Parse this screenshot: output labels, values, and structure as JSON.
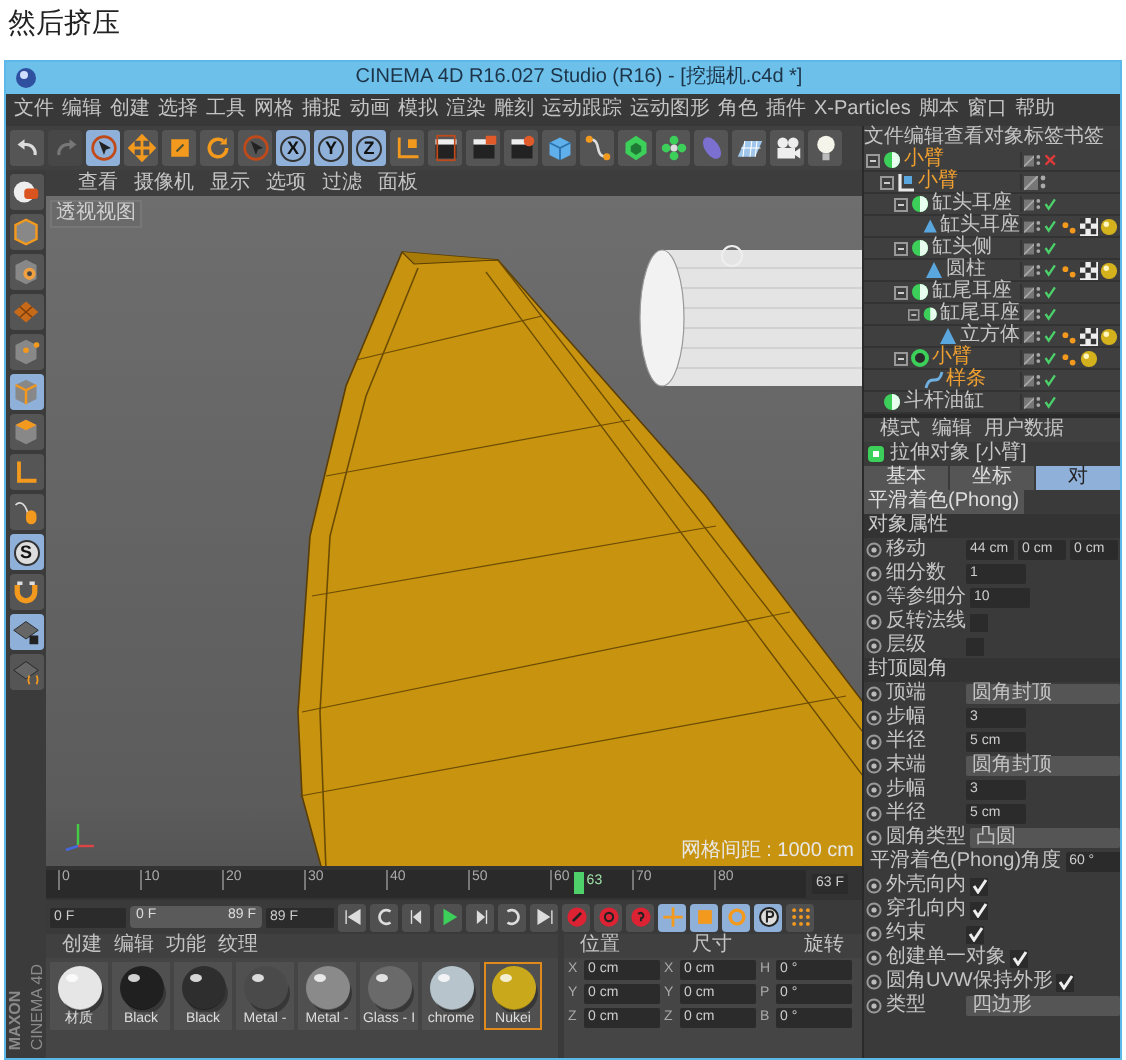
{
  "caption": "然后挤压",
  "window": {
    "title": "CINEMA 4D R16.027 Studio (R16) - [挖掘机.c4d *]"
  },
  "menu": [
    "文件",
    "编辑",
    "创建",
    "选择",
    "工具",
    "网格",
    "捕捉",
    "动画",
    "模拟",
    "渲染",
    "雕刻",
    "运动跟踪",
    "运动图形",
    "角色",
    "插件",
    "X-Particles",
    "脚本",
    "窗口",
    "帮助"
  ],
  "toolbar": [
    {
      "selected": false,
      "disabled": false
    },
    {
      "selected": false,
      "disabled": true
    },
    {
      "selected": true,
      "disabled": false
    },
    {
      "selected": false,
      "disabled": false
    },
    {
      "selected": false,
      "disabled": false
    },
    {
      "selected": false,
      "disabled": false
    },
    {
      "selected": false,
      "disabled": false
    },
    {
      "label": "X",
      "selected": true,
      "disabled": false
    },
    {
      "label": "Y",
      "selected": true,
      "disabled": false
    },
    {
      "label": "Z",
      "selected": true,
      "disabled": false
    },
    {
      "selected": false,
      "disabled": false
    },
    {
      "selected": false,
      "disabled": false
    },
    {
      "selected": false,
      "disabled": false
    },
    {
      "selected": false,
      "disabled": false
    },
    {
      "selected": false,
      "disabled": false
    },
    {
      "selected": false,
      "disabled": false
    },
    {
      "selected": false,
      "disabled": false
    },
    {
      "selected": false,
      "disabled": false
    },
    {
      "selected": false,
      "disabled": false
    },
    {
      "selected": false,
      "disabled": false
    },
    {
      "selected": false,
      "disabled": false
    },
    {
      "selected": false,
      "disabled": false
    }
  ],
  "left_toolbar": [
    {
      "selected": false
    },
    {
      "selected": false
    },
    {
      "selected": false
    },
    {
      "selected": false
    },
    {
      "selected": false
    },
    {
      "selected": true
    },
    {
      "selected": false
    },
    {
      "selected": false
    },
    {
      "selected": false
    },
    {
      "label": "S",
      "selected": true
    },
    {
      "selected": false
    },
    {
      "selected": true
    },
    {
      "selected": false
    }
  ],
  "viewport": {
    "menu": [
      "查看",
      "摄像机",
      "显示",
      "选项",
      "过滤",
      "面板"
    ],
    "label": "透视视图",
    "grid_spacing": "网格间距 : 1000 cm"
  },
  "timeline": {
    "ticks": [
      "0",
      "10",
      "20",
      "30",
      "40",
      "50",
      "60",
      "70",
      "80"
    ],
    "playhead": {
      "label": "63",
      "level": 0.7
    },
    "frame_field": "63 F"
  },
  "playback": {
    "start": "0 F",
    "range": {
      "labels": [
        "0 F",
        "89 F"
      ],
      "level": 1
    },
    "end": "89 F",
    "modes": [
      {
        "selected": true
      },
      {
        "selected": true
      },
      {
        "selected": true
      },
      {
        "selected": true
      },
      {
        "selected": false
      }
    ]
  },
  "materials": {
    "menu": [
      "创建",
      "编辑",
      "功能",
      "纹理"
    ],
    "items": [
      {
        "name": "材质",
        "color": "#e6e6e6",
        "selected": false
      },
      {
        "name": "Black",
        "color": "#202020",
        "selected": false
      },
      {
        "name": "Black",
        "color": "#2e2e2e",
        "selected": false
      },
      {
        "name": "Metal -",
        "color": "#4a4a4a",
        "selected": false
      },
      {
        "name": "Metal -",
        "color": "#8a8a8a",
        "selected": false
      },
      {
        "name": "Glass - I",
        "color": "#6a6a6a",
        "selected": false
      },
      {
        "name": "chrome",
        "color": "#b8c4cc",
        "selected": false
      },
      {
        "name": "Nukei",
        "color": "#c9a81c",
        "selected": true
      }
    ]
  },
  "coordinates": {
    "headers": [
      "位置",
      "尺寸",
      "旋转"
    ],
    "rows": [
      [
        {
          "axis": "X",
          "value": "0 cm"
        },
        {
          "axis": "X",
          "value": "0 cm"
        },
        {
          "axis": "H",
          "value": "0 °"
        }
      ],
      [
        {
          "axis": "Y",
          "value": "0 cm"
        },
        {
          "axis": "Y",
          "value": "0 cm"
        },
        {
          "axis": "P",
          "value": "0 °"
        }
      ],
      [
        {
          "axis": "Z",
          "value": "0 cm"
        },
        {
          "axis": "Z",
          "value": "0 cm"
        },
        {
          "axis": "B",
          "value": "0 °"
        }
      ]
    ]
  },
  "logo": {
    "brand": "MAXON",
    "product": "CINEMA 4D"
  },
  "objects": {
    "menu": [
      "文件",
      "编辑",
      "查看",
      "对象",
      "标签",
      "书签"
    ],
    "tree": [
      {
        "name": "小臂",
        "kind": "null",
        "selected": true,
        "enabled": false,
        "children": [
          {
            "name": "小臂",
            "kind": "extrude",
            "selected": true,
            "children": [
              {
                "name": "缸头耳座",
                "kind": "null",
                "selected": false,
                "enabled": true,
                "children": [
                  {
                    "name": "缸头耳座",
                    "kind": "polygon",
                    "selected": false,
                    "enabled": true,
                    "tags": [
                      {
                        "kind": "phong"
                      },
                      {
                        "kind": "uvw"
                      },
                      {
                        "kind": "material"
                      }
                    ]
                  }
                ]
              },
              {
                "name": "缸头侧",
                "kind": "null",
                "selected": false,
                "enabled": true,
                "children": [
                  {
                    "name": "圆柱",
                    "kind": "polygon",
                    "selected": false,
                    "enabled": true,
                    "tags": [
                      {
                        "kind": "phong"
                      },
                      {
                        "kind": "uvw"
                      },
                      {
                        "kind": "material"
                      }
                    ]
                  }
                ]
              },
              {
                "name": "缸尾耳座",
                "kind": "null",
                "selected": false,
                "enabled": true,
                "children": [
                  {
                    "name": "缸尾耳座",
                    "kind": "null",
                    "selected": false,
                    "enabled": true,
                    "children": [
                      {
                        "name": "立方体",
                        "kind": "polygon",
                        "selected": false,
                        "enabled": true,
                        "tags": [
                          {
                            "kind": "phong"
                          },
                          {
                            "kind": "uvw"
                          },
                          {
                            "kind": "material"
                          }
                        ]
                      }
                    ]
                  }
                ]
              },
              {
                "name": "小臂",
                "kind": "subdiv",
                "selected": true,
                "enabled": true,
                "tags": [
                  {
                    "kind": "phong"
                  },
                  {
                    "kind": "material"
                  }
                ],
                "children": [
                  {
                    "name": "样条",
                    "kind": "spline",
                    "selected": true,
                    "enabled": true
                  }
                ]
              }
            ]
          }
        ]
      },
      {
        "name": "斗杆油缸",
        "kind": "null",
        "selected": false,
        "enabled": true
      }
    ]
  },
  "attributes": {
    "menu": [
      "模式",
      "编辑",
      "用户数据"
    ],
    "title": "拉伸对象 [小臂]",
    "tabs": [
      {
        "label": "基本",
        "selected": false
      },
      {
        "label": "坐标",
        "selected": false
      },
      {
        "label": "对",
        "selected": true
      },
      {
        "label": "平滑着色(Phong)",
        "selected": false
      }
    ],
    "sections": [
      {
        "title": "对象属性",
        "rows": [
          {
            "kind": "fields",
            "label": "移动",
            "values": [
              "44 cm",
              "0 cm",
              "0 cm"
            ]
          },
          {
            "kind": "fields",
            "label": "细分数",
            "values": [
              "1"
            ]
          },
          {
            "kind": "fields",
            "label": "等参细分",
            "values": [
              "10"
            ]
          },
          {
            "kind": "check",
            "label": "反转法线",
            "checked": false
          },
          {
            "kind": "check",
            "label": "层级",
            "checked": false
          }
        ]
      },
      {
        "title": "封顶圆角",
        "rows": [
          {
            "kind": "select",
            "label": "顶端",
            "value": "圆角封顶"
          },
          {
            "kind": "fields",
            "label": "步幅",
            "values": [
              "3"
            ]
          },
          {
            "kind": "fields",
            "label": "半径",
            "values": [
              "5 cm"
            ]
          },
          {
            "kind": "select",
            "label": "末端",
            "value": "圆角封顶"
          },
          {
            "kind": "fields",
            "label": "步幅",
            "values": [
              "3"
            ]
          },
          {
            "kind": "fields",
            "label": "半径",
            "values": [
              "5 cm"
            ]
          },
          {
            "kind": "select",
            "label": "圆角类型",
            "value": "凸圆"
          },
          {
            "kind": "fields",
            "label": "平滑着色(Phong)角度",
            "values": [
              "60 °"
            ]
          },
          {
            "kind": "check",
            "label": "外壳向内",
            "checked": true
          },
          {
            "kind": "check",
            "label": "穿孔向内",
            "checked": true
          },
          {
            "kind": "check",
            "label": "约束",
            "checked": true
          },
          {
            "kind": "check",
            "label": "创建单一对象",
            "checked": true
          },
          {
            "kind": "check",
            "label": "圆角UVW保持外形",
            "checked": true
          },
          {
            "kind": "select",
            "label": "类型",
            "value": "四边形"
          }
        ]
      }
    ]
  }
}
